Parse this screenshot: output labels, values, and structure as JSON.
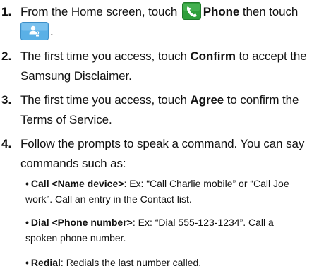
{
  "steps": [
    {
      "number": "1.",
      "text_before_phone": "From the Home screen, touch ",
      "phone_label": "Phone",
      "text_after_phone": " then touch",
      "text_end": "."
    },
    {
      "number": "2.",
      "line1_a": "The first time you access, touch ",
      "bold": "Confirm",
      "line1_b": " to accept the",
      "line2": "Samsung Disclaimer."
    },
    {
      "number": "3.",
      "line1_a": "The first time you access, touch ",
      "bold": "Agree",
      "line1_b": " to confirm the",
      "line2": "Terms of Service."
    },
    {
      "number": "4.",
      "line1": "Follow the prompts to speak a command. You can say",
      "line2": "commands such as:"
    }
  ],
  "bullets": [
    {
      "dot": "•",
      "bold": "Call <Name device>",
      "line1": ": Ex: “Call Charlie mobile” or “Call Joe",
      "line2": "work”. Call an entry in the Contact list."
    },
    {
      "dot": "•",
      "bold": "Dial <Phone number>",
      "line1": ": Ex: “Dial 555-123-1234”. Call a",
      "line2": "spoken phone number."
    },
    {
      "dot": "•",
      "bold": "Redial",
      "line1": ": Redials the last number called."
    }
  ],
  "icons": {
    "phone": "phone-app-icon",
    "voice": "voice-dial-button-icon"
  },
  "colors": {
    "phone_icon_bg": "#2f9e3a",
    "voice_icon_bg": "#5ab0e6"
  }
}
